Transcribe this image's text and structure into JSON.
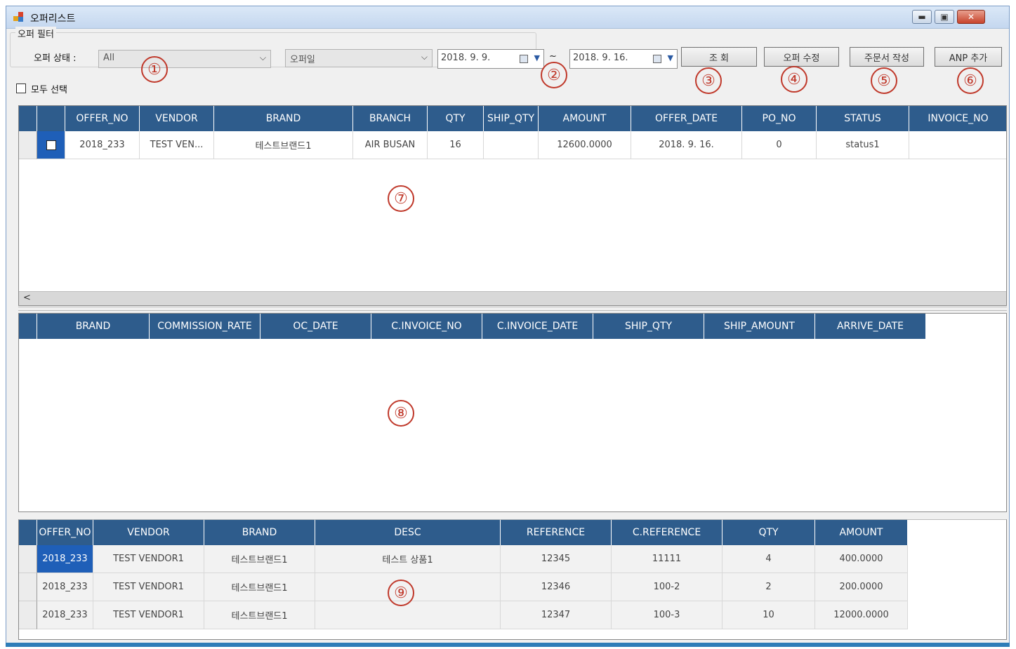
{
  "window": {
    "title": "오퍼리스트",
    "minimize": "▬",
    "maximize": "▣",
    "close": "✕"
  },
  "filter": {
    "group_label": "오퍼 필터",
    "status_label": "오퍼 상태 :",
    "status_value": "All",
    "date_type_value": "오퍼일",
    "date_from": "2018.  9.  9.",
    "date_to": "2018.  9. 16.",
    "tilde": "~",
    "search_button": "조 회",
    "edit_button": "오퍼 수정",
    "order_button": "주문서 작성",
    "anp_button": "ANP 추가",
    "select_all_label": "모두 선택"
  },
  "callouts": [
    "①",
    "②",
    "③",
    "④",
    "⑤",
    "⑥",
    "⑦",
    "⑧",
    "⑨"
  ],
  "grid_offers": {
    "columns": [
      "OFFER_NO",
      "VENDOR",
      "BRAND",
      "BRANCH",
      "QTY",
      "SHIP_QTY",
      "AMOUNT",
      "OFFER_DATE",
      "PO_NO",
      "STATUS",
      "INVOICE_NO"
    ],
    "rows": [
      [
        "2018_233",
        "TEST VEN...",
        "테스트브랜드1",
        "AIR BUSAN",
        "16",
        "",
        "12600.0000",
        "2018. 9. 16.",
        "0",
        "status1",
        ""
      ]
    ]
  },
  "grid_shipments": {
    "columns": [
      "BRAND",
      "COMMISSION_RATE",
      "OC_DATE",
      "C.INVOICE_NO",
      "C.INVOICE_DATE",
      "SHIP_QTY",
      "SHIP_AMOUNT",
      "ARRIVE_DATE"
    ],
    "rows": []
  },
  "grid_items": {
    "columns": [
      "OFFER_NO",
      "VENDOR",
      "BRAND",
      "DESC",
      "REFERENCE",
      "C.REFERENCE",
      "QTY",
      "AMOUNT"
    ],
    "rows": [
      [
        "2018_233",
        "TEST VENDOR1",
        "테스트브랜드1",
        "테스트 상품1",
        "12345",
        "11111",
        "4",
        "400.0000"
      ],
      [
        "2018_233",
        "TEST VENDOR1",
        "테스트브랜드1",
        "",
        "12346",
        "100-2",
        "2",
        "200.0000"
      ],
      [
        "2018_233",
        "TEST VENDOR1",
        "테스트브랜드1",
        "",
        "12347",
        "100-3",
        "10",
        "12000.0000"
      ]
    ]
  }
}
